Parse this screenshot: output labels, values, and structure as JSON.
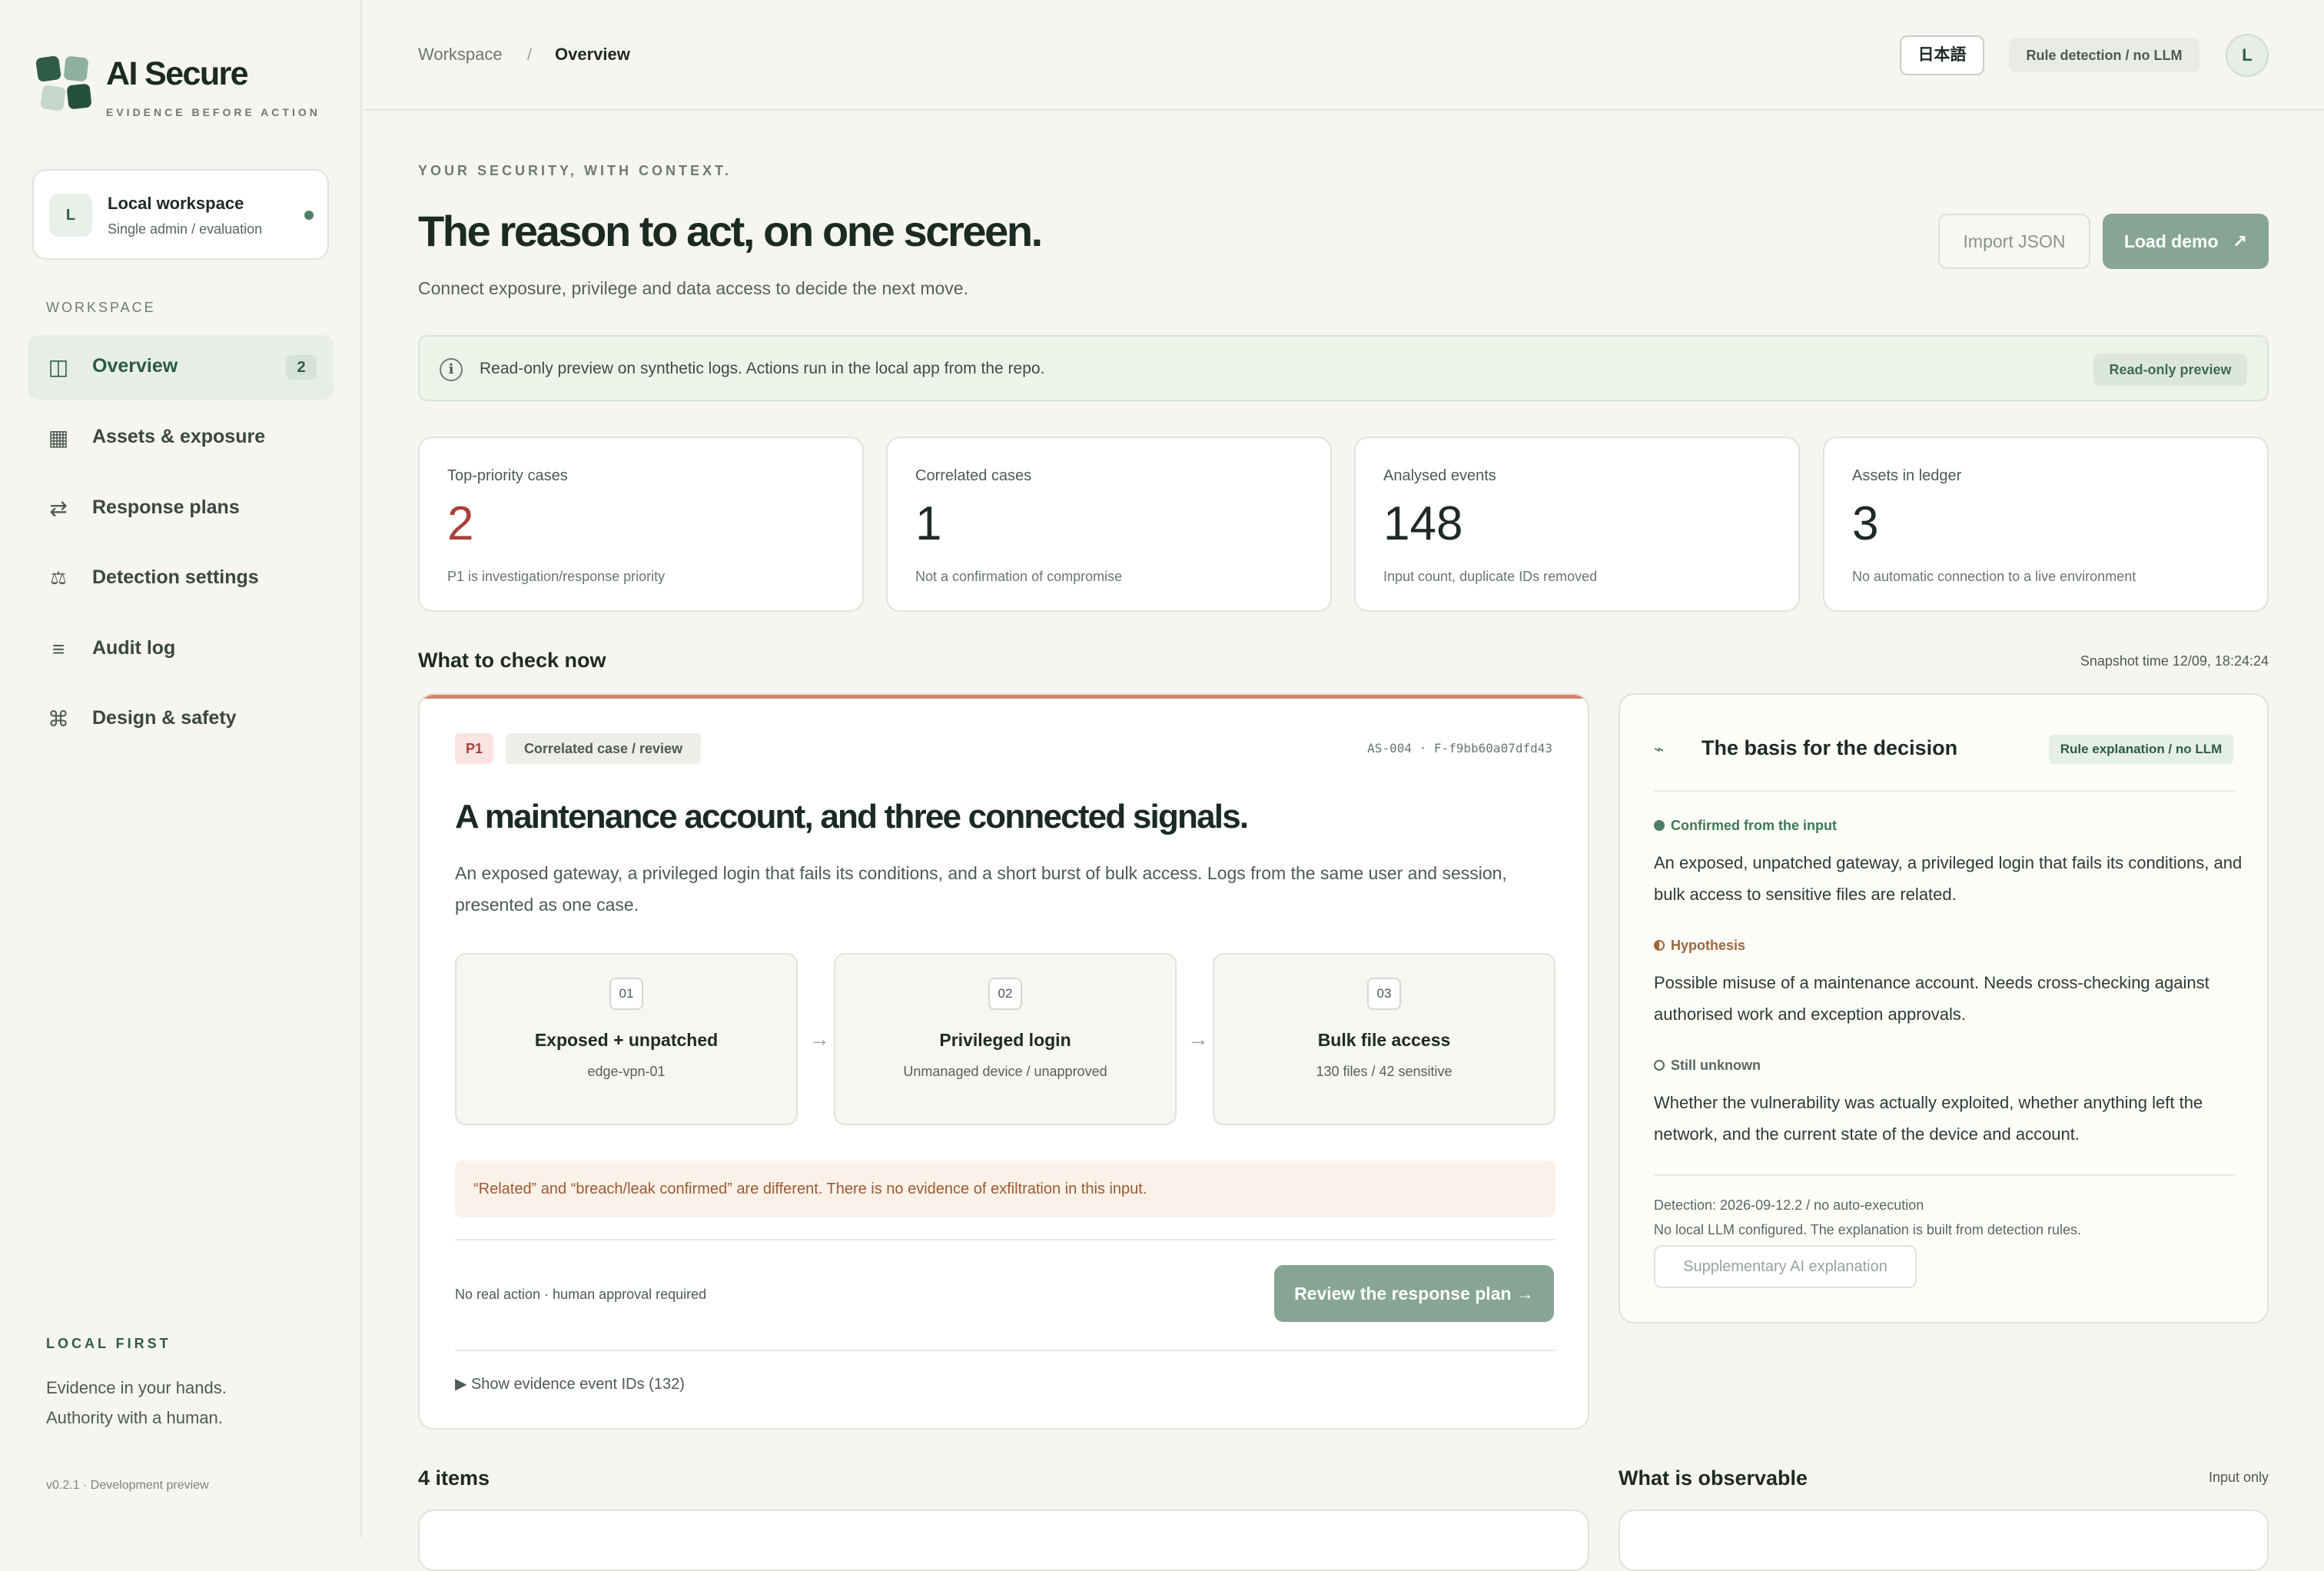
{
  "brand": {
    "name": "AI Secure",
    "tagline": "EVIDENCE BEFORE ACTION"
  },
  "workspace_card": {
    "avatar": "L",
    "title": "Local workspace",
    "subtitle": "Single admin / evaluation"
  },
  "sidebar": {
    "section_label": "WORKSPACE",
    "items": [
      {
        "label": "Overview",
        "badge": "2",
        "icon": "columns-icon",
        "glyph": "◫",
        "active": true
      },
      {
        "label": "Assets & exposure",
        "icon": "grid-icon",
        "glyph": "▦",
        "active": false
      },
      {
        "label": "Response plans",
        "icon": "swap-arrows-icon",
        "glyph": "⇄",
        "active": false
      },
      {
        "label": "Detection settings",
        "icon": "scales-icon",
        "glyph": "⚖",
        "active": false
      },
      {
        "label": "Audit log",
        "icon": "list-icon",
        "glyph": "≡",
        "active": false
      },
      {
        "label": "Design & safety",
        "icon": "command-icon",
        "glyph": "⌘",
        "active": false
      }
    ],
    "footer": {
      "title": "LOCAL FIRST",
      "line1": "Evidence in your hands.",
      "line2": "Authority with a human.",
      "version": "v0.2.1 · Development preview"
    }
  },
  "topbar": {
    "breadcrumb": [
      "Workspace",
      "/",
      "Overview"
    ],
    "language_button": "日本語",
    "mode_chip": "Rule detection / no LLM",
    "user_avatar": "L"
  },
  "hero": {
    "eyebrow": "YOUR SECURITY, WITH CONTEXT.",
    "title": "The reason to act, on one screen.",
    "subtitle": "Connect exposure, privilege and data access to decide the next move.",
    "import_button": "Import JSON",
    "demo_button": "Load demo",
    "demo_icon": "↗"
  },
  "info_bar": {
    "icon": "i",
    "text": "Read-only preview on synthetic logs. Actions run in the local app from the repo.",
    "chip": "Read-only preview"
  },
  "stats": [
    {
      "label": "Top-priority cases",
      "value": "2",
      "note": "P1 is investigation/response priority"
    },
    {
      "label": "Correlated cases",
      "value": "1",
      "note": "Not a confirmation of compromise"
    },
    {
      "label": "Analysed events",
      "value": "148",
      "note": "Input count, duplicate IDs removed"
    },
    {
      "label": "Assets in ledger",
      "value": "3",
      "note": "No automatic connection to a live environment"
    }
  ],
  "colors": {
    "accent": "#86a595",
    "brand": "#2f5b48",
    "alert": "#a8413a",
    "case_topline": "#d4846a"
  },
  "check_now": {
    "title": "What to check now",
    "snapshot": "Snapshot time 12/09, 18:24:24",
    "case": {
      "priority": "P1",
      "kind": "Correlated case / review",
      "ids": "AS-004 · F-f9bb60a07dfd43",
      "title": "A maintenance account, and three connected signals.",
      "description": "An exposed gateway, a privileged login that fails its conditions, and a short burst of bulk access. Logs from the same user and session, presented as one case.",
      "steps": [
        {
          "num": "01",
          "title": "Exposed + unpatched",
          "sub": "edge-vpn-01"
        },
        {
          "num": "02",
          "title": "Privileged login",
          "sub": "Unmanaged device / unapproved"
        },
        {
          "num": "03",
          "title": "Bulk file access",
          "sub": "130 files / 42 sensitive"
        }
      ],
      "arrow": "→",
      "warning": "“Related” and “breach/leak confirmed” are different. There is no evidence of exfiltration in this input.",
      "approval_note": "No real action · human approval required",
      "review_button": "Review the response plan →",
      "evidence_toggle": "▶ Show evidence event IDs (132)"
    }
  },
  "basis": {
    "icon": "⌁",
    "title": "The basis for the decision",
    "chip": "Rule explanation / no LLM",
    "confirmed_label": "Confirmed from the input",
    "confirmed_text": "An exposed, unpatched gateway, a privileged login that fails its conditions, and bulk access to sensitive files are related.",
    "hypothesis_label": "Hypothesis",
    "hypothesis_text": "Possible misuse of a maintenance account. Needs cross-checking against authorised work and exception approvals.",
    "unknown_label": "Still unknown",
    "unknown_text": "Whether the vulnerability was actually exploited, whether anything left the network, and the current state of the device and account.",
    "detection_meta": "Detection: 2026-09-12.2 / no auto-execution",
    "llm_meta": "No local LLM configured. The explanation is built from detection rules.",
    "supplementary_button": "Supplementary AI explanation"
  },
  "bottom": {
    "items_title": "4 items",
    "observable_title": "What is observable",
    "observable_note": "Input only"
  }
}
